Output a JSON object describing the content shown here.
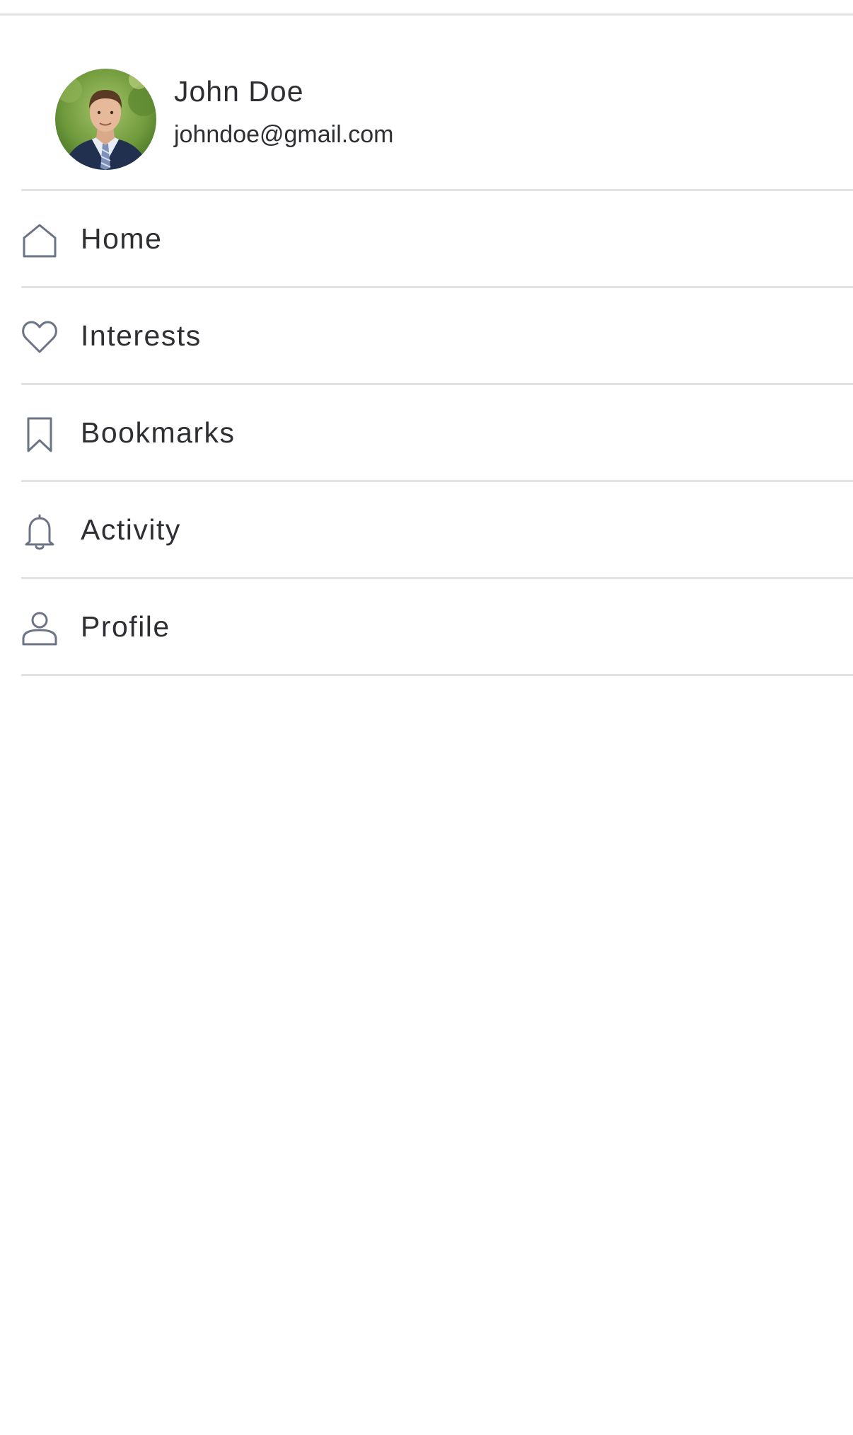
{
  "user": {
    "name": "John Doe",
    "email": "johndoe@gmail.com"
  },
  "menu": {
    "items": [
      {
        "label": "Home",
        "icon": "home-icon"
      },
      {
        "label": "Interests",
        "icon": "heart-icon"
      },
      {
        "label": "Bookmarks",
        "icon": "bookmark-icon"
      },
      {
        "label": "Activity",
        "icon": "bell-icon"
      },
      {
        "label": "Profile",
        "icon": "person-icon"
      }
    ]
  },
  "colors": {
    "text": "#2d2f33",
    "icon": "#6b7385",
    "divider": "#e3e3e6"
  }
}
